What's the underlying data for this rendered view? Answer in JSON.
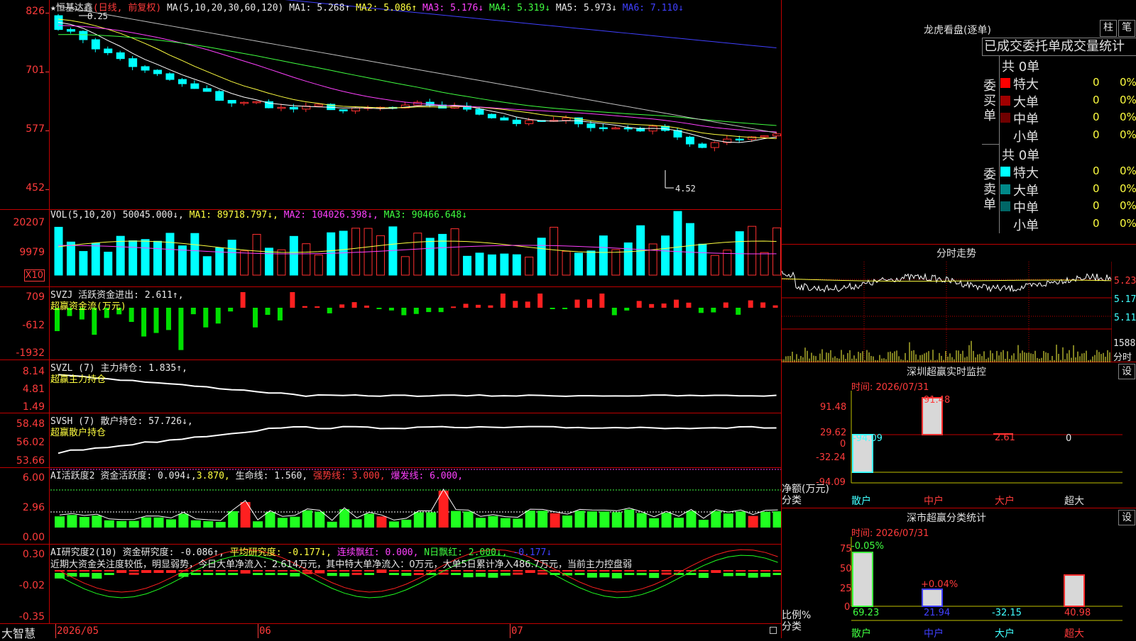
{
  "main": {
    "title_star": "★",
    "stock_name": "恒基达鑫",
    "period": "(日线, 前复权)",
    "ma_label": "MA(5,10,20,30,60,120)",
    "ma1": "MA1: 5.268↑",
    "ma2": "MA2: 5.086↑",
    "ma3": "MA3: 5.176↓",
    "ma4": "MA4: 5.319↓",
    "ma5": "MA5: 5.973↓",
    "ma6": "MA6: 7.110↓",
    "y_labels": [
      "826",
      "701",
      "577",
      "452"
    ],
    "high_note": "8.25",
    "low_note": "4.52"
  },
  "vol": {
    "label": "VOL(5,10,20)",
    "value": "50045.000↓,",
    "ma1": "MA1: 89718.797↓,",
    "ma2": "MA2: 104026.398↓,",
    "ma3": "MA3: 90466.648↓",
    "y_labels": [
      "20207",
      "9979"
    ],
    "unit": "X10"
  },
  "svzj": {
    "label": "SVZJ",
    "title": "活跃资金进出: 2.611↑,",
    "subtitle": "超赢资金流(万元)",
    "y_labels": [
      "709",
      "-612",
      "-1932"
    ]
  },
  "svzl": {
    "label": "SVZL (7)",
    "title": "主力持仓: 1.835↑,",
    "subtitle": "超赢主力持仓",
    "y_labels": [
      "8.14",
      "4.81",
      "1.49"
    ]
  },
  "svsh": {
    "label": "SVSH (7)",
    "title": "散户持仓: 57.726↓,",
    "subtitle": "超赢散户持仓",
    "y_labels": [
      "58.48",
      "56.02",
      "53.66"
    ]
  },
  "ai1": {
    "label": "AI活跃度2",
    "t1": "资金活跃度: 0.094↓,",
    "t2": "3.870,",
    "t3": "生命线: 1.560,",
    "t4": "强势线: 3.000,",
    "t5": "爆发线: 6.000,",
    "y_labels": [
      "6.00",
      "2.96",
      "0.00"
    ]
  },
  "ai2": {
    "label": "AI研究度2(10)",
    "t1": "资金研究度: -0.086↑,",
    "t2": "平均研究度: -0.177↓,",
    "t3": "连续飘红: 0.000,",
    "t4": "N日飘红: 2.000↓,",
    "t5": "-0.177↓",
    "summary": "近期大资金关注度较低，明显弱势，今日大单净流入：2.614万元，其中特大单净流入：0万元，大单5日累计净入486.7万元，当前主力控盘弱",
    "y_labels": [
      "0.30",
      "-0.02",
      "-0.35"
    ]
  },
  "xaxis": {
    "brand": "大智慧",
    "labels": [
      "2026/05",
      "06",
      "07"
    ]
  },
  "dragon": {
    "title": "龙虎看盘(逐单)",
    "btn1": "柱",
    "btn2": "笔",
    "tab_label": "已成交委托单成交量统计",
    "buy_label": "委买单",
    "sell_label": "委卖单",
    "buy_total": "共 0单",
    "sell_total": "共 0单",
    "buy_rows": [
      {
        "name": "特大",
        "count": "0",
        "pct": "0%",
        "color": "#ff0000"
      },
      {
        "name": "大单",
        "count": "0",
        "pct": "0%",
        "color": "#a00000"
      },
      {
        "name": "中单",
        "count": "0",
        "pct": "0%",
        "color": "#700000"
      },
      {
        "name": "小单",
        "count": "0",
        "pct": "0%",
        "color": "#000000"
      }
    ],
    "sell_rows": [
      {
        "name": "特大",
        "count": "0",
        "pct": "0%",
        "color": "#00ffff"
      },
      {
        "name": "大单",
        "count": "0",
        "pct": "0%",
        "color": "#008888"
      },
      {
        "name": "中单",
        "count": "0",
        "pct": "0%",
        "color": "#006666"
      },
      {
        "name": "小单",
        "count": "0",
        "pct": "0%",
        "color": "#000000"
      }
    ]
  },
  "minute": {
    "title": "分时走势",
    "y_labels": [
      "5.23",
      "5.17",
      "5.11"
    ],
    "vol_label": "1588",
    "vol_unit": "分时"
  },
  "sz_monitor": {
    "title": "深圳超赢实时监控",
    "setting": "设",
    "time": "时间: 2026/07/31",
    "y_labels": [
      "91.48",
      "29.62",
      "0",
      "-32.24",
      "-94.09"
    ],
    "net_label": "净额(万元)",
    "class_label": "分类",
    "bar_values": [
      "-94.09",
      "91.48",
      "2.61",
      "0"
    ],
    "categories": [
      "散户",
      "中户",
      "大户",
      "超大"
    ]
  },
  "sz_class": {
    "title": "深市超赢分类统计",
    "setting": "设",
    "time": "时间: 2026/07/31",
    "y_labels": [
      "75",
      "50",
      "25",
      "0"
    ],
    "top_values": [
      "-0.05%",
      "+0.04%"
    ],
    "ratio_label": "比例%",
    "class_label": "分类",
    "bottom_values": [
      "69.23",
      "21.94",
      "-32.15",
      "40.98"
    ],
    "categories": [
      "散户",
      "中户",
      "大户",
      "超大"
    ]
  }
}
